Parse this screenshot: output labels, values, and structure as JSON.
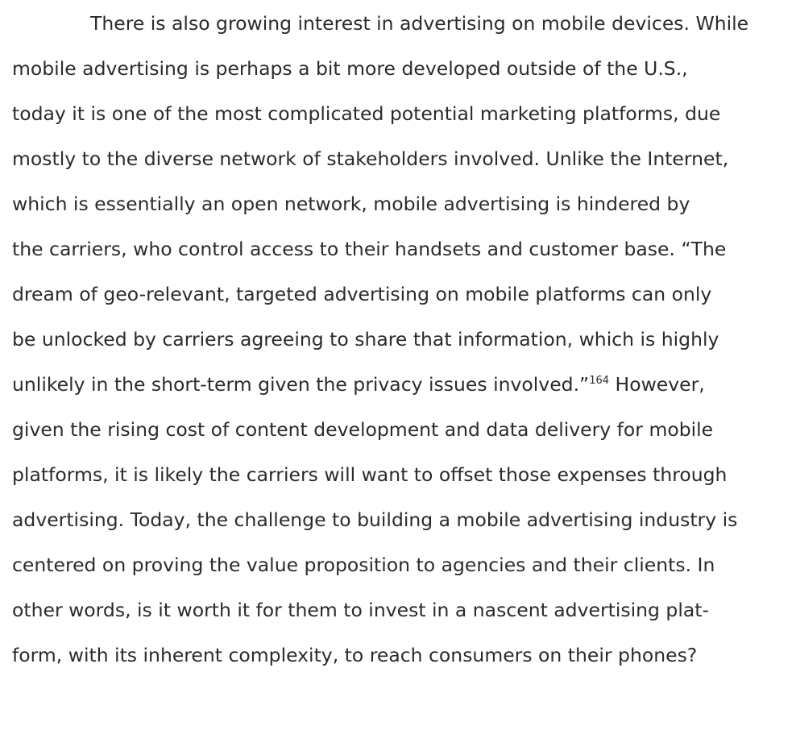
{
  "document": {
    "lines": [
      "There is also growing interest in advertising on mobile devices. While",
      "mobile advertising is perhaps a bit more developed outside of the U.S.,",
      "today it is one of the most complicated potential marketing platforms, due",
      "mostly to the diverse network of stakeholders involved. Unlike the Internet,",
      "which is essentially an open network, mobile advertising is hindered by",
      "the carriers, who control access to their handsets and customer base. “The",
      "dream of geo-relevant, targeted advertising on mobile platforms can only",
      "be unlocked by carriers agreeing to share that information, which is highly",
      "unlikely in the short-term given the privacy issues involved.”",
      "given the rising cost of content development and data delivery for mobile",
      "platforms, it is likely the carriers will want to offset those expenses through",
      "advertising. Today, the challenge to building a mobile advertising industry is",
      "centered on proving the value proposition to agencies and their clients. In",
      "other words, is it worth it for them to invest in a nascent advertising plat-",
      "form, with its inherent complexity, to reach consumers on their phones?"
    ],
    "footnote_ref": "164",
    "line9_after_footnote": " However,"
  }
}
